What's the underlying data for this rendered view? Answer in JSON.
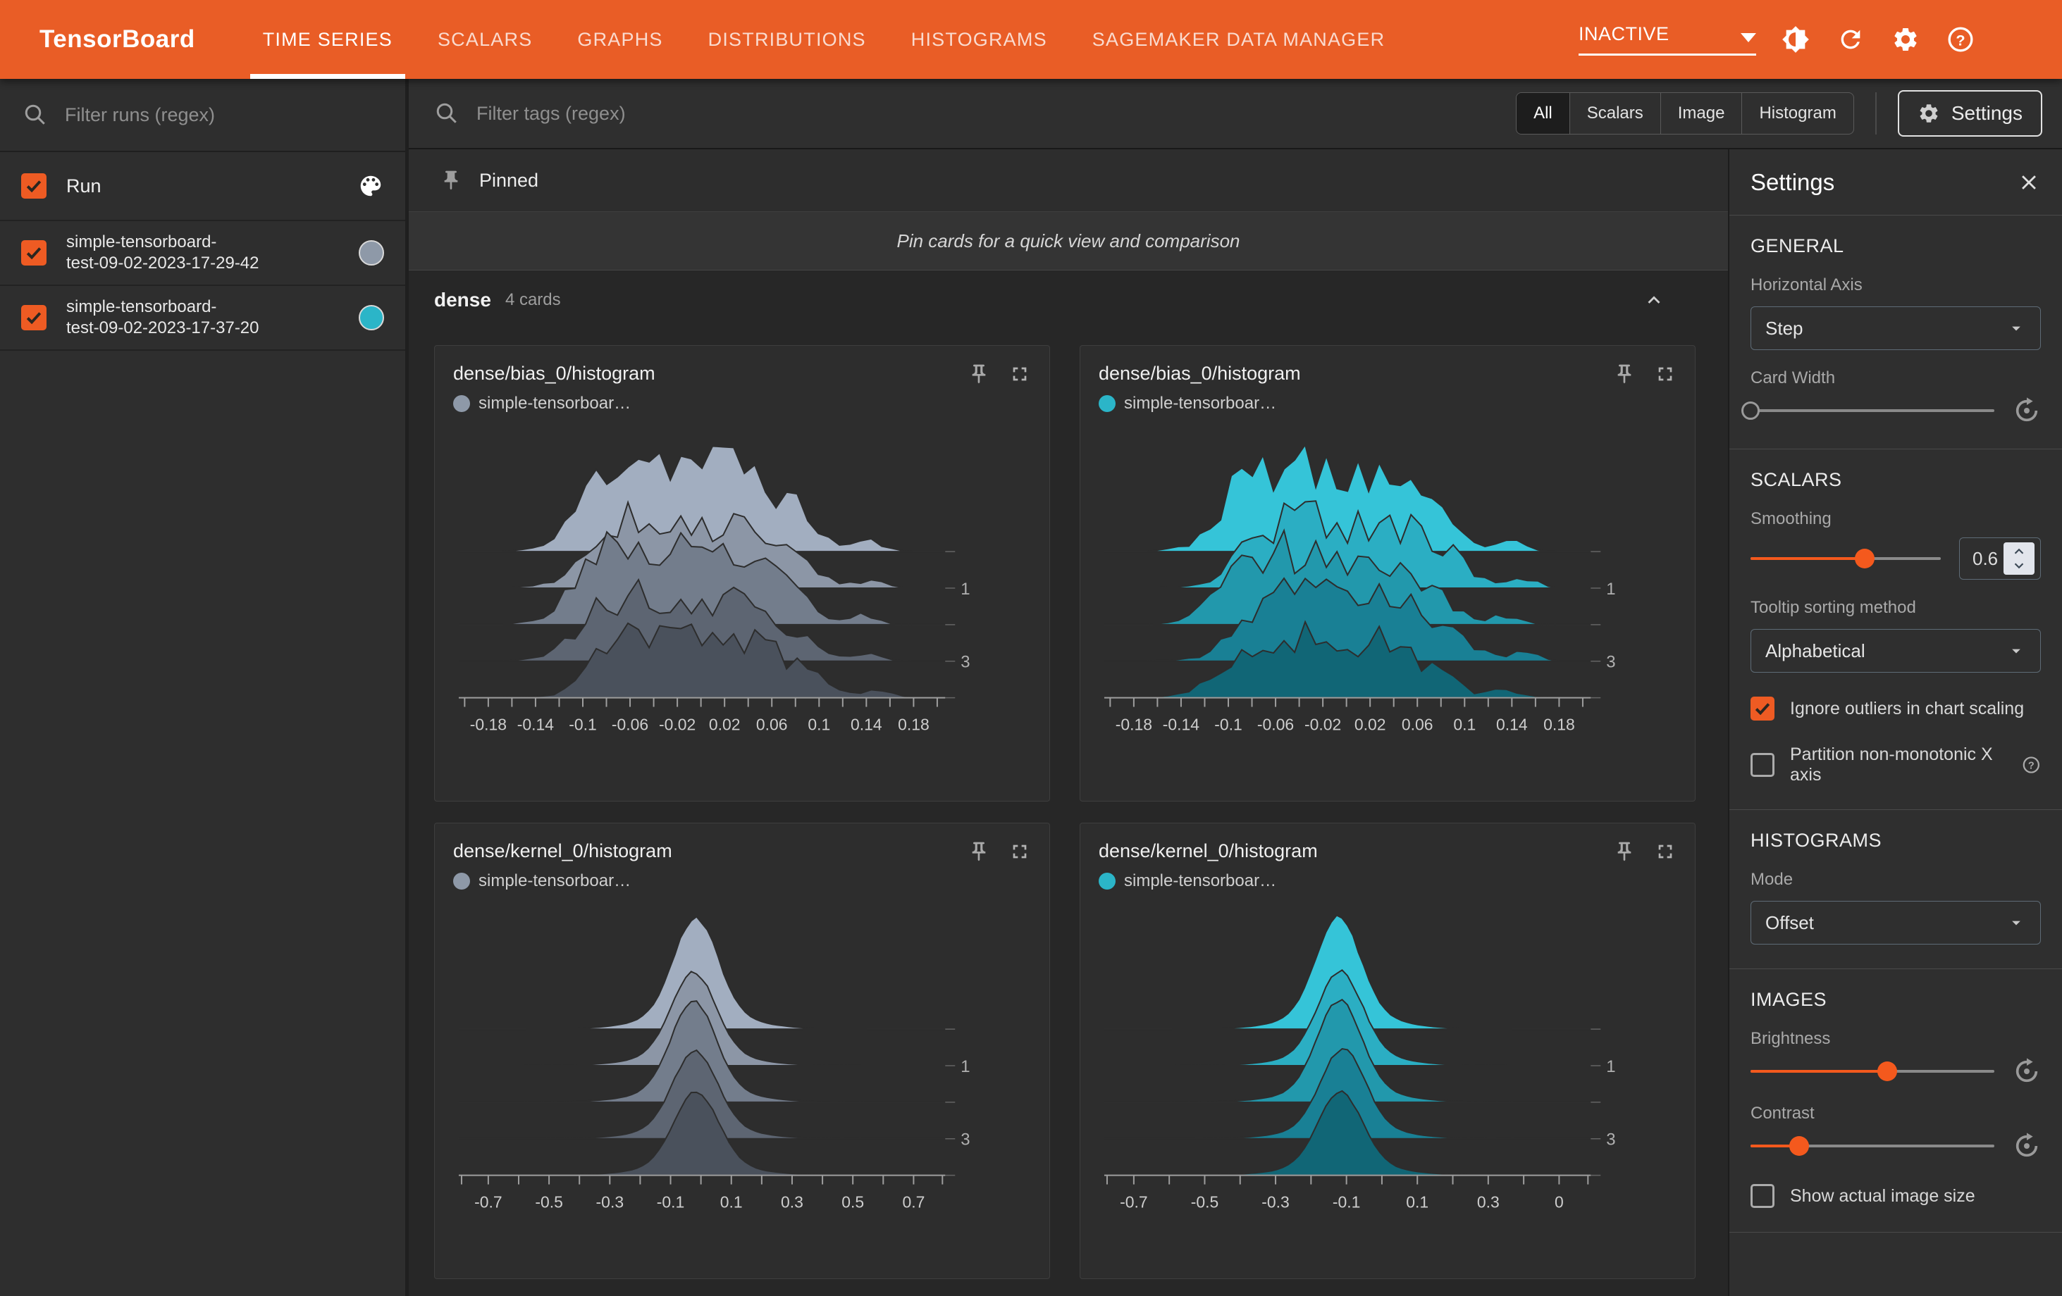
{
  "header": {
    "logo": "TensorBoard",
    "tabs": [
      {
        "label": "TIME SERIES",
        "active": true
      },
      {
        "label": "SCALARS",
        "active": false
      },
      {
        "label": "GRAPHS",
        "active": false
      },
      {
        "label": "DISTRIBUTIONS",
        "active": false
      },
      {
        "label": "HISTOGRAMS",
        "active": false
      },
      {
        "label": "SAGEMAKER DATA MANAGER",
        "active": false
      }
    ],
    "status_dropdown": {
      "value": "INACTIVE"
    },
    "icons": [
      "brightness-icon",
      "refresh-icon",
      "settings-gear-icon",
      "help-icon"
    ]
  },
  "runs_sidebar": {
    "filter_placeholder": "Filter runs (regex)",
    "header": {
      "label": "Run",
      "checked": true,
      "icon": "palette-icon"
    },
    "runs": [
      {
        "line1": "simple-tensorboard-",
        "line2": "test-09-02-2023-17-29-42",
        "full_name": "simple-tensorboard-test-09-02-2023-17-29-42",
        "color": "#8E99A8",
        "checked": true
      },
      {
        "line1": "simple-tensorboard-",
        "line2": "test-09-02-2023-17-37-20",
        "full_name": "simple-tensorboard-test-09-02-2023-17-37-20",
        "color": "#2BB5C8",
        "checked": true
      }
    ]
  },
  "toolbar": {
    "tag_filter_placeholder": "Filter tags (regex)",
    "chips": [
      {
        "label": "All",
        "selected": true
      },
      {
        "label": "Scalars",
        "selected": false
      },
      {
        "label": "Image",
        "selected": false
      },
      {
        "label": "Histogram",
        "selected": false
      }
    ],
    "settings_button": "Settings"
  },
  "pinned": {
    "label": "Pinned",
    "hint": "Pin cards for a quick view and comparison"
  },
  "section": {
    "name": "dense",
    "count": "4 cards"
  },
  "settings_panel": {
    "title": "Settings",
    "general": {
      "heading": "GENERAL",
      "horizontal_axis_label": "Horizontal Axis",
      "horizontal_axis_value": "Step",
      "card_width_label": "Card Width",
      "card_width_fraction": 0
    },
    "scalars": {
      "heading": "SCALARS",
      "smoothing_label": "Smoothing",
      "smoothing_value": "0.6",
      "smoothing_fraction": 0.6,
      "tooltip_sorting_label": "Tooltip sorting method",
      "tooltip_sorting_value": "Alphabetical",
      "ignore_outliers": {
        "label": "Ignore outliers in chart scaling",
        "checked": true
      },
      "partition_x": {
        "label": "Partition non-monotonic X axis",
        "checked": false
      }
    },
    "histograms": {
      "heading": "HISTOGRAMS",
      "mode_label": "Mode",
      "mode_value": "Offset"
    },
    "images": {
      "heading": "IMAGES",
      "brightness_label": "Brightness",
      "brightness_fraction": 0.56,
      "contrast_label": "Contrast",
      "contrast_fraction": 0.2,
      "show_actual": {
        "label": "Show actual image size",
        "checked": false
      }
    }
  },
  "chart_data": [
    {
      "id": "card-0",
      "type": "histogram_ridgeline",
      "title": "dense/bias_0/histogram",
      "run": "simple-tensorboard-test-09-02-2023-17-29-42",
      "legend_label": "simple-tensorboar…",
      "run_color": "#8E99A8",
      "x_ticks": [
        "-0.18",
        "-0.14",
        "-0.1",
        "-0.06",
        "-0.02",
        "0.02",
        "0.06",
        "0.1",
        "0.14",
        "0.18"
      ],
      "x_range": [
        -0.2,
        0.2
      ],
      "y_axis": "step",
      "num_steps": 5,
      "step_separation": 52,
      "step_labels": [
        {
          "text": "1",
          "step": 1
        },
        {
          "text": "3",
          "step": 3
        }
      ],
      "palette": [
        "#A2AEC0",
        "#8C96A6",
        "#737D8C",
        "#5D6572",
        "#4A515C"
      ],
      "bg": "#2D2D2D",
      "seed": 11,
      "noise": 0.3,
      "layer_jitter": 0.05,
      "samples": 46,
      "support": [
        0.1,
        0.93
      ],
      "amplitudes": [
        150,
        122,
        132,
        116,
        106
      ],
      "components": [
        {
          "a": 1.0,
          "mu": 0.46,
          "s": 0.12
        },
        {
          "a": 0.5,
          "mu": 0.33,
          "s": 0.055
        },
        {
          "a": 0.45,
          "mu": 0.6,
          "s": 0.05
        },
        {
          "a": 0.3,
          "mu": 0.7,
          "s": 0.04
        },
        {
          "a": 0.22,
          "mu": 0.26,
          "s": 0.035
        },
        {
          "a": 0.12,
          "mu": 0.84,
          "s": 0.03
        }
      ]
    },
    {
      "id": "card-1",
      "type": "histogram_ridgeline",
      "title": "dense/bias_0/histogram",
      "run": "simple-tensorboard-test-09-02-2023-17-37-20",
      "legend_label": "simple-tensorboar…",
      "run_color": "#2BB5C8",
      "x_ticks": [
        "-0.18",
        "-0.14",
        "-0.1",
        "-0.06",
        "-0.02",
        "0.02",
        "0.06",
        "0.1",
        "0.14",
        "0.18"
      ],
      "x_range": [
        -0.2,
        0.2
      ],
      "y_axis": "step",
      "num_steps": 5,
      "step_separation": 52,
      "step_labels": [
        {
          "text": "1",
          "step": 1
        },
        {
          "text": "3",
          "step": 3
        }
      ],
      "palette": [
        "#35C4D8",
        "#2BAEC3",
        "#2298AC",
        "#198095",
        "#116676"
      ],
      "bg": "#2D2D2D",
      "seed": 23,
      "noise": 0.33,
      "layer_jitter": 0.05,
      "samples": 46,
      "support": [
        0.1,
        0.93
      ],
      "amplitudes": [
        152,
        124,
        134,
        118,
        108
      ],
      "components": [
        {
          "a": 1.0,
          "mu": 0.47,
          "s": 0.12
        },
        {
          "a": 0.5,
          "mu": 0.34,
          "s": 0.055
        },
        {
          "a": 0.45,
          "mu": 0.61,
          "s": 0.05
        },
        {
          "a": 0.3,
          "mu": 0.71,
          "s": 0.04
        },
        {
          "a": 0.2,
          "mu": 0.27,
          "s": 0.035
        },
        {
          "a": 0.14,
          "mu": 0.85,
          "s": 0.03
        }
      ]
    },
    {
      "id": "card-2",
      "type": "histogram_ridgeline",
      "title": "dense/kernel_0/histogram",
      "run": "simple-tensorboard-test-09-02-2023-17-29-42",
      "legend_label": "simple-tensorboar…",
      "run_color": "#8E99A8",
      "x_ticks": [
        "-0.7",
        "-0.5",
        "-0.3",
        "-0.1",
        "0.1",
        "0.3",
        "0.5",
        "0.7"
      ],
      "x_range": [
        -0.8,
        0.8
      ],
      "y_axis": "step",
      "num_steps": 5,
      "step_separation": 52,
      "step_labels": [
        {
          "text": "1",
          "step": 1
        },
        {
          "text": "3",
          "step": 3
        }
      ],
      "palette": [
        "#A2AEC0",
        "#8C96A6",
        "#737D8C",
        "#5D6572",
        "#4A515C"
      ],
      "bg": "#2D2D2D",
      "seed": 37,
      "noise": 0.02,
      "layer_jitter": 0.012,
      "samples": 90,
      "support": [
        0.12,
        0.92
      ],
      "amplitudes": [
        160,
        134,
        144,
        126,
        118
      ],
      "components": [
        {
          "a": 1.0,
          "mu": 0.487,
          "s": 0.045
        },
        {
          "a": 0.16,
          "mu": 0.49,
          "s": 0.1
        }
      ]
    },
    {
      "id": "card-3",
      "type": "histogram_ridgeline",
      "title": "dense/kernel_0/histogram",
      "run": "simple-tensorboard-test-09-02-2023-17-37-20",
      "legend_label": "simple-tensorboar…",
      "run_color": "#2BB5C8",
      "x_ticks": [
        "-0.7",
        "-0.5",
        "-0.3",
        "-0.1",
        "0.1",
        "0.3",
        "0"
      ],
      "x_range": [
        -0.8,
        0.8
      ],
      "y_axis": "step",
      "num_steps": 5,
      "step_separation": 52,
      "step_labels": [
        {
          "text": "1",
          "step": 1
        },
        {
          "text": "3",
          "step": 3
        }
      ],
      "palette": [
        "#35C4D8",
        "#2BAEC3",
        "#2298AC",
        "#198095",
        "#116676"
      ],
      "bg": "#2D2D2D",
      "seed": 51,
      "noise": 0.02,
      "layer_jitter": 0.012,
      "samples": 90,
      "support": [
        0.12,
        0.92
      ],
      "amplitudes": [
        162,
        136,
        146,
        128,
        120
      ],
      "components": [
        {
          "a": 1.0,
          "mu": 0.485,
          "s": 0.045
        },
        {
          "a": 0.16,
          "mu": 0.49,
          "s": 0.1
        }
      ]
    }
  ]
}
